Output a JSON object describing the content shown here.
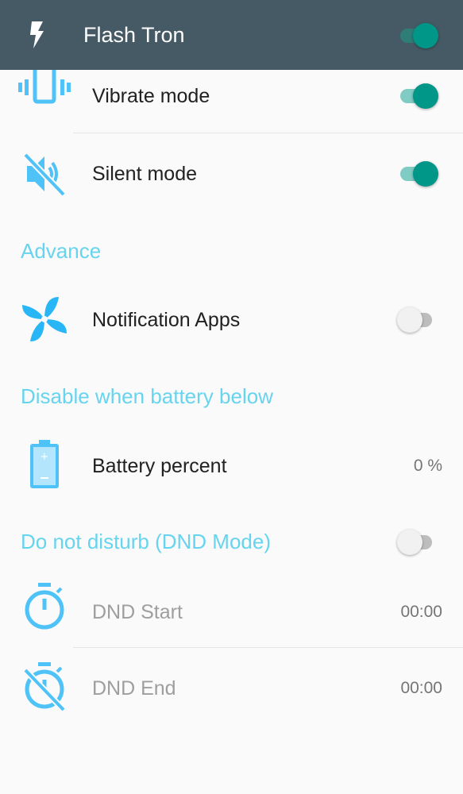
{
  "appbar": {
    "title": "Flash Tron",
    "icon": "flash-icon",
    "toggle_on": true
  },
  "rows": {
    "vibrate": {
      "label": "Vibrate mode",
      "icon": "vibrate-icon",
      "toggle_on": true
    },
    "silent": {
      "label": "Silent mode",
      "icon": "volume-off-icon",
      "toggle_on": true
    },
    "notification_apps": {
      "label": "Notification Apps",
      "icon": "fan-icon",
      "toggle_on": false
    },
    "battery": {
      "label": "Battery percent",
      "icon": "battery-icon",
      "value": "0 %"
    },
    "dnd_start": {
      "label": "DND Start",
      "icon": "timer-icon",
      "value": "00:00"
    },
    "dnd_end": {
      "label": "DND End",
      "icon": "timer-off-icon",
      "value": "00:00"
    }
  },
  "sections": {
    "advance": "Advance",
    "battery": "Disable when battery below",
    "dnd": {
      "label": "Do not disturb (DND Mode)",
      "toggle_on": false
    }
  },
  "colors": {
    "appbar": "#455a64",
    "accent": "#67d4ef",
    "switch_on": "#009688",
    "icon": "#4fc3f7"
  }
}
